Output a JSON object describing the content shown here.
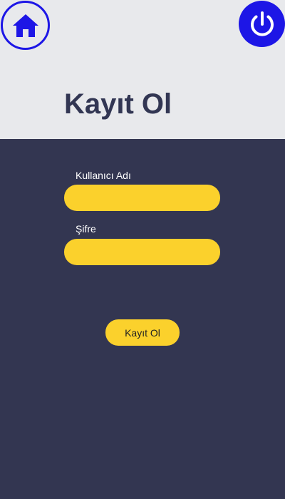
{
  "header": {
    "title": "Kayıt Ol",
    "home_icon": "home-icon",
    "power_icon": "power-icon"
  },
  "form": {
    "username_label": "Kullanıcı Adı",
    "username_value": "",
    "password_label": "Şifre",
    "password_value": "",
    "submit_label": "Kayıt Ol"
  },
  "colors": {
    "accent_blue": "#1d16e6",
    "panel_background": "#333651",
    "top_background": "#e8e9ec",
    "input_yellow": "#fbd12c",
    "title_color": "#323653"
  }
}
